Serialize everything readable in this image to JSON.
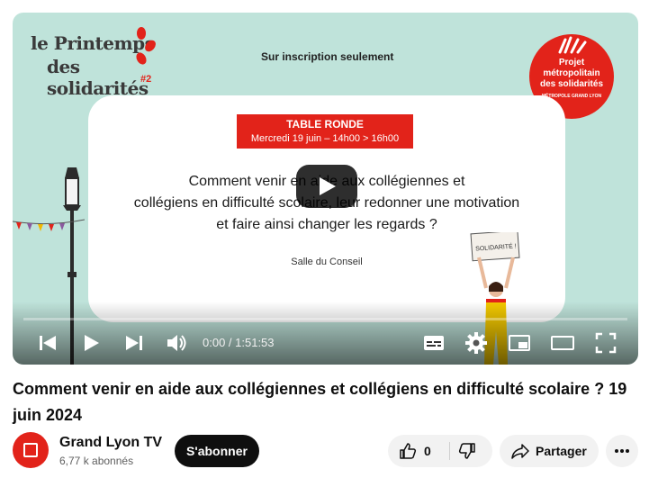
{
  "video": {
    "slide": {
      "logo_left_line1": "le Printemps",
      "logo_left_line2": "des solidarités",
      "logo_left_edition": "#2",
      "top_caption": "Sur inscription seulement",
      "logo_right_lines": [
        "Projet",
        "métropolitain",
        "des solidarités",
        "MÉTROPOLE GRAND LYON"
      ],
      "badge_title": "TABLE RONDE",
      "badge_date": "Mercredi 19 juin – 14h00 > 16h00",
      "question_lines": [
        "Comment venir en aide aux collégiennes et",
        "collégiens en difficulté scolaire, leur redonner une motivation",
        "et faire ainsi changer les regards ?"
      ],
      "room": "Salle du Conseil",
      "sign_text": "SOLIDARITÉ !"
    },
    "player": {
      "time_display": "0:00 / 1:51:53",
      "progress": 0.0
    }
  },
  "meta": {
    "title": "Comment venir en aide aux collégiennes et collégiens en difficulté scolaire ? 19 juin 2024",
    "channel_name": "Grand Lyon TV",
    "subscribers": "6,77 k abonnés",
    "subscribe_label": "S'abonner",
    "like_count": "0",
    "share_label": "Partager"
  },
  "colors": {
    "accent": "#e2231a",
    "slide_bg": "#bfe3da"
  }
}
